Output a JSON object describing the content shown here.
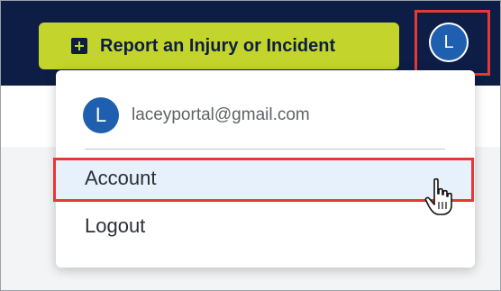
{
  "header": {
    "report_button_label": "Report an Injury or Incident",
    "avatar_initial": "L"
  },
  "user_menu": {
    "avatar_initial": "L",
    "email": "laceyportal@gmail.com",
    "items": [
      {
        "label": "Account",
        "state": "hovered"
      },
      {
        "label": "Logout"
      }
    ]
  },
  "colors": {
    "header_bg": "#0e1d45",
    "accent_button": "#c3d52d",
    "avatar_blue": "#1f5fb0",
    "highlight_red": "#e53935",
    "hover_bg": "#e6f1fb"
  },
  "icons": {
    "report_button": "plus-square-icon",
    "cursor": "hand-pointer-cursor-icon"
  }
}
